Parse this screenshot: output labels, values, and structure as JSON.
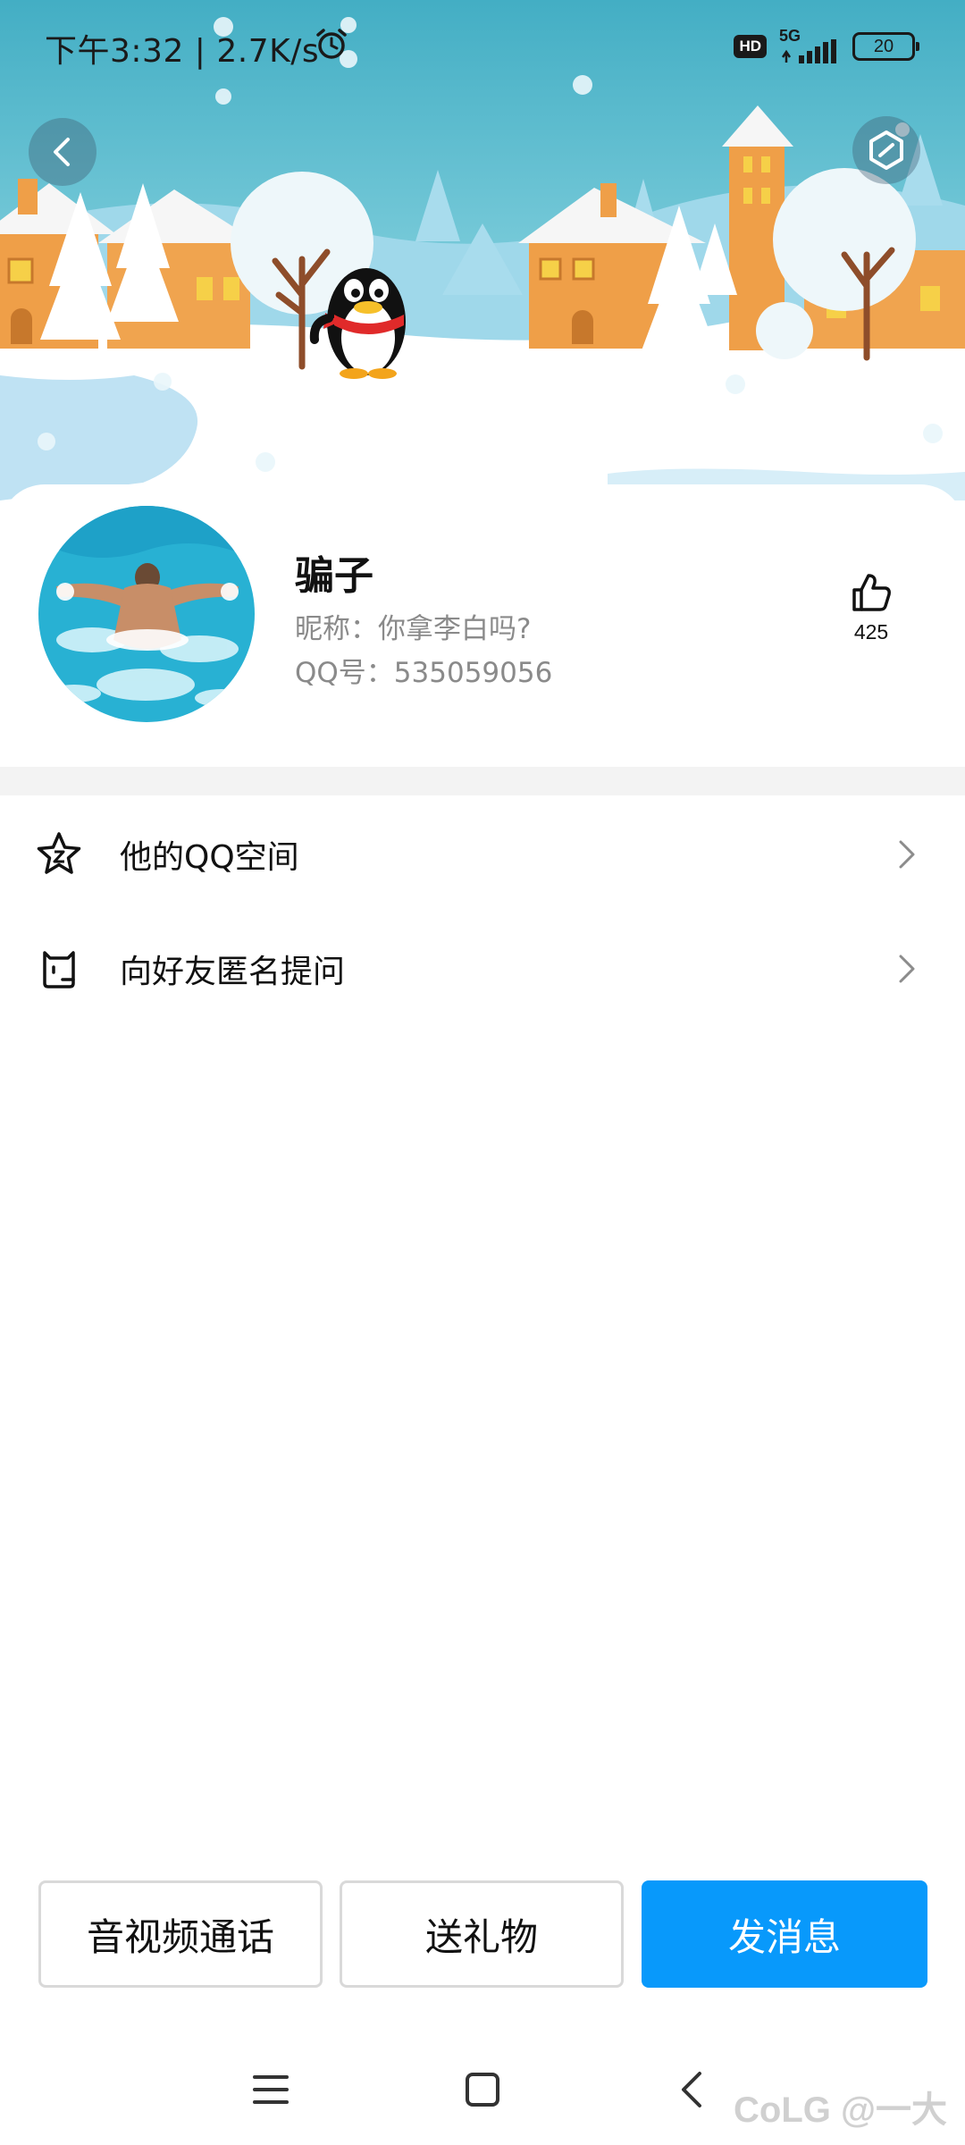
{
  "status_bar": {
    "time": "下午3:32 | 2.7K/s",
    "hd_badge": "HD",
    "network": "5G",
    "battery": "20",
    "alarm_icon": "alarm-clock-icon",
    "signal_icon": "signal-bars-icon"
  },
  "header": {
    "back_icon": "chevron-left-icon",
    "settings_icon": "hexagon-settings-icon",
    "banner_theme": "snow-village-with-penguin",
    "colors": {
      "sky_top": "#4db5c9",
      "sky_bottom": "#b7e6ef",
      "snow": "#ffffff",
      "ice": "#bfe2f3",
      "house": "#ef9f48"
    }
  },
  "profile": {
    "display_name": "骗子",
    "nickname": "昵称：你拿李白吗?",
    "qq_number": "QQ号：535059056",
    "likes": "425",
    "like_icon": "thumbs-up-icon",
    "avatar": "swimmer-butterfly-photo"
  },
  "menu": [
    {
      "label": "他的QQ空间",
      "icon": "qzone-star-icon"
    },
    {
      "label": "向好友匿名提问",
      "icon": "anonymous-question-icon"
    }
  ],
  "actions": {
    "call": "音视频通话",
    "gift": "送礼物",
    "message": "发消息",
    "primary_color": "#0899fb"
  },
  "nav_bar": {
    "menu_icon": "hamburger-icon",
    "home_icon": "square-home-icon",
    "back_icon": "triangle-back-icon"
  },
  "watermark": "CoLG @一大"
}
